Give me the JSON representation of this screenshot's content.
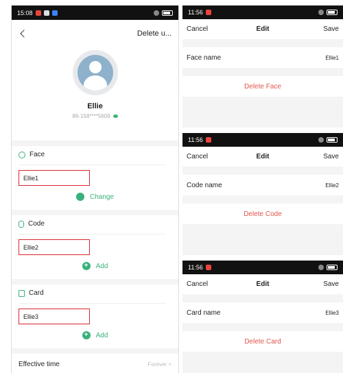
{
  "left": {
    "status_time": "15:08",
    "header_action": "Delete u...",
    "user_name": "Ellie",
    "user_phone": "86-158****5609",
    "face": {
      "title": "Face",
      "value": "Ellie1",
      "action": "Change"
    },
    "code": {
      "title": "Code",
      "value": "Ellie2",
      "action": "Add"
    },
    "card": {
      "title": "Card",
      "value": "Ellie3",
      "action": "Add"
    },
    "effective_label": "Effective time",
    "effective_value": "Forever >"
  },
  "panels": [
    {
      "status_time": "11:56",
      "cancel": "Cancel",
      "title": "Edit",
      "save": "Save",
      "row_label": "Face name",
      "row_value": "Ellie1",
      "delete": "Delete Face"
    },
    {
      "status_time": "11:56",
      "cancel": "Cancel",
      "title": "Edit",
      "save": "Save",
      "row_label": "Code name",
      "row_value": "Ellie2",
      "delete": "Delete Code"
    },
    {
      "status_time": "11:56",
      "cancel": "Cancel",
      "title": "Edit",
      "save": "Save",
      "row_label": "Card name",
      "row_value": "Ellie3",
      "delete": "Delete Card"
    }
  ],
  "colors": {
    "accent": "#3ab07a",
    "highlight_box": "#d9262c",
    "delete_text": "#e0564a"
  }
}
